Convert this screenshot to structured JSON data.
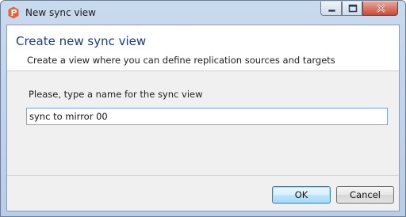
{
  "window": {
    "title": "New sync view",
    "icon": "sync-app-icon"
  },
  "header": {
    "title": "Create new sync view",
    "description": "Create a view where you can define replication sources and targets"
  },
  "form": {
    "name_label": "Please, type a name for the sync view",
    "name_value": "sync to mirror 00"
  },
  "buttons": {
    "ok": "OK",
    "cancel": "Cancel"
  },
  "colors": {
    "header_title": "#1f3a7a",
    "app_icon": "#e2643c"
  }
}
